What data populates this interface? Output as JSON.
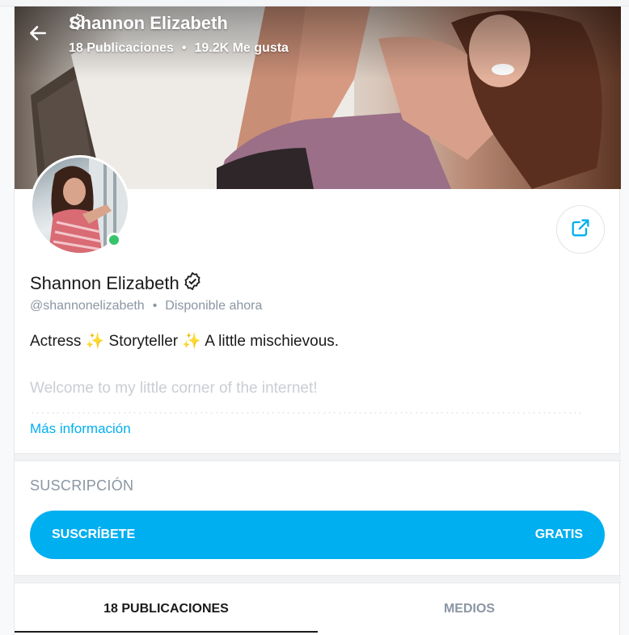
{
  "header": {
    "name": "Shannon Elizabeth",
    "posts": "18 Publicaciones",
    "separator": "•",
    "likes": "19.2K Me gusta",
    "icons": {
      "back": "arrow-left-icon",
      "verified": "verified-badge-icon"
    }
  },
  "profile": {
    "name": "Shannon Elizabeth",
    "handle": "@shannonelizabeth",
    "separator": "•",
    "availability": "Disponible ahora",
    "bio_line": "Actress ✨ Storyteller ✨ A little mischievous.",
    "bio_welcome": "Welcome to my little corner of the internet!",
    "more_info": "Más información",
    "online_color": "#38c46b",
    "icons": {
      "share": "share-icon",
      "verified": "verified-badge-icon"
    }
  },
  "subscription": {
    "heading": "SUSCRIPCIÓN",
    "button_label": "SUSCRÍBETE",
    "price": "GRATIS",
    "accent": "#00aff0"
  },
  "tabs": [
    {
      "label": "18 PUBLICACIONES",
      "active": true
    },
    {
      "label": "MEDIOS",
      "active": false
    }
  ]
}
